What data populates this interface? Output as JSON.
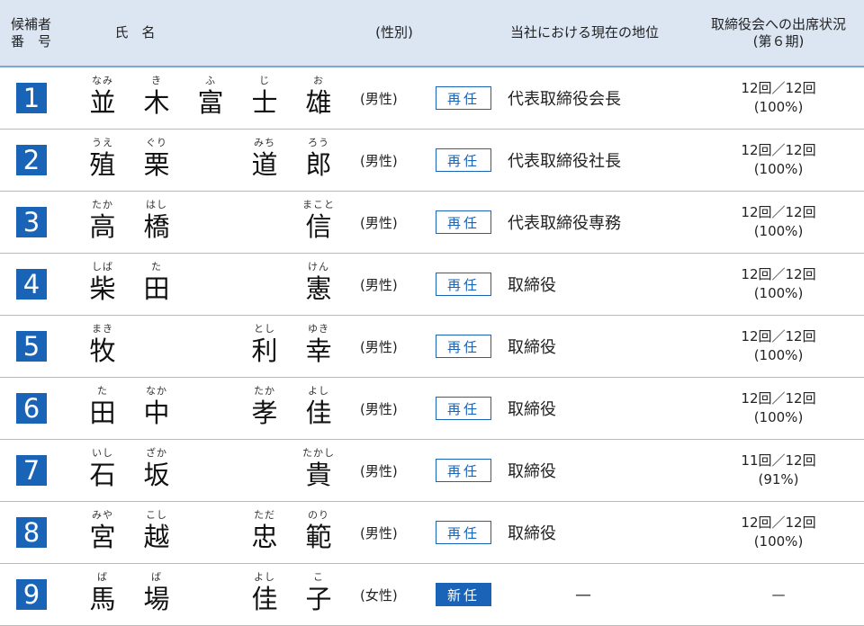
{
  "header": {
    "num_line1": "候補者",
    "num_line2": "番　号",
    "name": "氏　名",
    "gender": "(性別)",
    "position": "当社における現在の地位",
    "attendance_line1": "取締役会への出席状況",
    "attendance_line2": "(第６期)"
  },
  "badges": {
    "reappointed": "再任",
    "new": "新任"
  },
  "rows": [
    {
      "num": "1",
      "kanji": [
        "並",
        "木",
        "富",
        "士",
        "雄"
      ],
      "ruby": [
        "なみ",
        "き",
        "ふ",
        "じ",
        "お"
      ],
      "gender": "(男性)",
      "badge": "再任",
      "position": "代表取締役会長",
      "att_count": "12回／12回",
      "att_rate": "(100%)"
    },
    {
      "num": "2",
      "kanji": [
        "殖",
        "栗",
        "",
        "道",
        "郎"
      ],
      "ruby": [
        "うえ",
        "ぐり",
        "",
        "みち",
        "ろう"
      ],
      "gender": "(男性)",
      "badge": "再任",
      "position": "代表取締役社長",
      "att_count": "12回／12回",
      "att_rate": "(100%)"
    },
    {
      "num": "3",
      "kanji": [
        "高",
        "橋",
        "",
        "",
        "信"
      ],
      "ruby": [
        "たか",
        "はし",
        "",
        "",
        "まこと"
      ],
      "gender": "(男性)",
      "badge": "再任",
      "position": "代表取締役専務",
      "att_count": "12回／12回",
      "att_rate": "(100%)"
    },
    {
      "num": "4",
      "kanji": [
        "柴",
        "田",
        "",
        "",
        "憲"
      ],
      "ruby": [
        "しば",
        "た",
        "",
        "",
        "けん"
      ],
      "gender": "(男性)",
      "badge": "再任",
      "position": "取締役",
      "att_count": "12回／12回",
      "att_rate": "(100%)"
    },
    {
      "num": "5",
      "kanji": [
        "牧",
        "",
        "",
        "利",
        "幸"
      ],
      "ruby": [
        "まき",
        "",
        "",
        "とし",
        "ゆき"
      ],
      "gender": "(男性)",
      "badge": "再任",
      "position": "取締役",
      "att_count": "12回／12回",
      "att_rate": "(100%)"
    },
    {
      "num": "6",
      "kanji": [
        "田",
        "中",
        "",
        "孝",
        "佳"
      ],
      "ruby": [
        "た",
        "なか",
        "",
        "たか",
        "よし"
      ],
      "gender": "(男性)",
      "badge": "再任",
      "position": "取締役",
      "att_count": "12回／12回",
      "att_rate": "(100%)"
    },
    {
      "num": "7",
      "kanji": [
        "石",
        "坂",
        "",
        "",
        "貴"
      ],
      "ruby": [
        "いし",
        "ざか",
        "",
        "",
        "たかし"
      ],
      "gender": "(男性)",
      "badge": "再任",
      "position": "取締役",
      "att_count": "11回／12回",
      "att_rate": "(91%)"
    },
    {
      "num": "8",
      "kanji": [
        "宮",
        "越",
        "",
        "忠",
        "範"
      ],
      "ruby": [
        "みや",
        "こし",
        "",
        "ただ",
        "のり"
      ],
      "gender": "(男性)",
      "badge": "再任",
      "position": "取締役",
      "att_count": "12回／12回",
      "att_rate": "(100%)"
    },
    {
      "num": "9",
      "kanji": [
        "馬",
        "場",
        "",
        "佳",
        "子"
      ],
      "ruby": [
        "ば",
        "ば",
        "",
        "よし",
        "こ"
      ],
      "gender": "(女性)",
      "badge": "新任",
      "position": "—",
      "att_count": "—",
      "att_rate": ""
    }
  ],
  "colors": {
    "accent": "#1a64b8",
    "header_bg": "#dce6f3"
  }
}
